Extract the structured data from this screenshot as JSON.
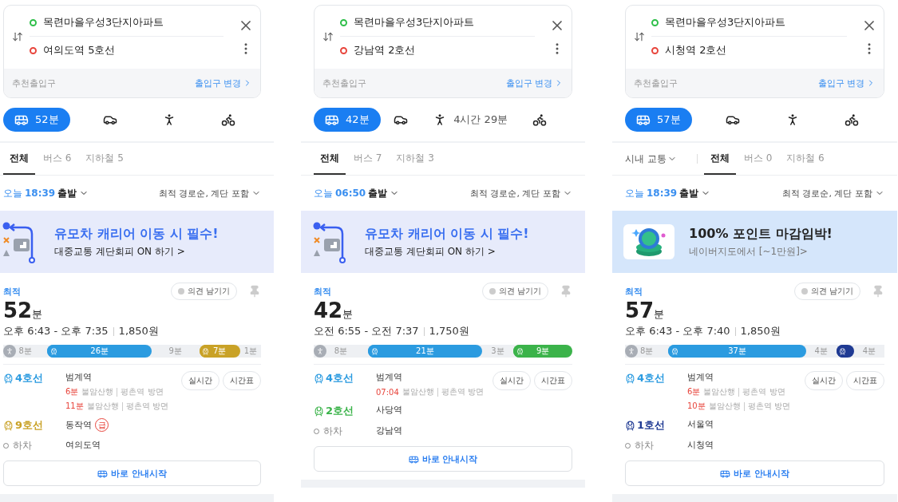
{
  "panels": [
    {
      "search": {
        "origin": "목련마을우성3단지아파트",
        "destination": "여의도역 5호선",
        "entrance_label": "추천출입구",
        "entrance_link": "출입구 변경"
      },
      "modes": [
        {
          "kind": "transit",
          "label": "52분",
          "selected": true
        },
        {
          "kind": "car",
          "selected": false
        },
        {
          "kind": "walk",
          "selected": false
        },
        {
          "kind": "bike",
          "selected": false
        }
      ],
      "tabs": [
        {
          "kind": "tab",
          "label": "전체",
          "selected": true
        },
        {
          "kind": "tab",
          "label": "버스 6",
          "selected": false
        },
        {
          "kind": "tab",
          "label": "지하철 5",
          "selected": false
        }
      ],
      "departure": {
        "day": "오늘",
        "time": "18:39",
        "suffix": "출발"
      },
      "sort": "최적 경로순, 계단 포함",
      "banner": {
        "kind": "stroller",
        "title": "유모차 캐리어 이동 시 필수!",
        "subtitle": "대중교통 계단회피 ON 하기 >"
      },
      "route": {
        "tag": "최적",
        "feedback": "의견 남기기",
        "duration": "52",
        "unit": "분",
        "times": "오후 6:43 - 오후 7:35",
        "fare": "1,850원",
        "segments": [
          {
            "kind": "walk",
            "label": "8분"
          },
          {
            "kind": "ride",
            "label": "26분",
            "color": "#2b9be0"
          },
          {
            "kind": "gap",
            "label": "9분"
          },
          {
            "kind": "ride",
            "label": "7분",
            "color": "#c9a227"
          },
          {
            "kind": "gap",
            "label": "1분"
          }
        ],
        "legs": [
          {
            "kind": "line",
            "name": "4호선",
            "color": "#2b9be0",
            "station": "범계역",
            "actions": [
              "실시간",
              "시간표"
            ],
            "arrivals": [
              {
                "wait": "6분",
                "dest": "불암산행",
                "direction": "평촌역 방면"
              },
              {
                "wait": "11분",
                "dest": "불암산행",
                "direction": "평촌역 방면"
              }
            ]
          },
          {
            "kind": "line",
            "name": "9호선",
            "color": "#c9a227",
            "station": "동작역",
            "badge": "급"
          },
          {
            "kind": "alight",
            "name": "하차",
            "station": "여의도역"
          }
        ],
        "start": "바로 안내시작"
      }
    },
    {
      "search": {
        "origin": "목련마을우성3단지아파트",
        "destination": "강남역 2호선",
        "entrance_label": "추천출입구",
        "entrance_link": "출입구 변경"
      },
      "modes": [
        {
          "kind": "transit",
          "label": "42분",
          "selected": true
        },
        {
          "kind": "car",
          "selected": false
        },
        {
          "kind": "walk",
          "label": "4시간 29분",
          "selected": false
        },
        {
          "kind": "bike",
          "selected": false
        }
      ],
      "tabs": [
        {
          "kind": "tab",
          "label": "전체",
          "selected": true
        },
        {
          "kind": "tab",
          "label": "버스 7",
          "selected": false
        },
        {
          "kind": "tab",
          "label": "지하철 3",
          "selected": false
        }
      ],
      "departure": {
        "day": "오늘",
        "time": "06:50",
        "suffix": "출발"
      },
      "sort": "최적 경로순, 계단 포함",
      "banner": {
        "kind": "stroller",
        "title": "유모차 캐리어 이동 시 필수!",
        "subtitle": "대중교통 계단회피 ON 하기 >"
      },
      "route": {
        "tag": "최적",
        "feedback": "의견 남기기",
        "duration": "42",
        "unit": "분",
        "times": "오전 6:55 - 오전 7:37",
        "fare": "1,750원",
        "segments": [
          {
            "kind": "walk",
            "label": "8분"
          },
          {
            "kind": "ride",
            "label": "21분",
            "color": "#2b9be0"
          },
          {
            "kind": "gap",
            "label": "3분"
          },
          {
            "kind": "ride",
            "label": "9분",
            "color": "#3bb34a"
          }
        ],
        "legs": [
          {
            "kind": "line",
            "name": "4호선",
            "color": "#2b9be0",
            "station": "범계역",
            "actions": [
              "실시간",
              "시간표"
            ],
            "arrivals": [
              {
                "wait": "07:04",
                "dest": "불암산행",
                "direction": "평촌역 방면"
              }
            ]
          },
          {
            "kind": "line",
            "name": "2호선",
            "color": "#3bb34a",
            "station": "사당역"
          },
          {
            "kind": "alight",
            "name": "하차",
            "station": "강남역"
          }
        ],
        "start": "바로 안내시작"
      }
    },
    {
      "search": {
        "origin": "목련마을우성3단지아파트",
        "destination": "시청역 2호선",
        "entrance_label": "추천출입구",
        "entrance_link": "출입구 변경"
      },
      "modes": [
        {
          "kind": "transit",
          "label": "57분",
          "selected": true
        },
        {
          "kind": "car",
          "selected": false
        },
        {
          "kind": "walk",
          "selected": false
        },
        {
          "kind": "bike",
          "selected": false
        }
      ],
      "tabs": [
        {
          "kind": "dropdown",
          "label": "시내 교통",
          "selected": false
        },
        {
          "kind": "tab",
          "label": "전체",
          "selected": true
        },
        {
          "kind": "tab",
          "label": "버스 0",
          "selected": false
        },
        {
          "kind": "tab",
          "label": "지하철 6",
          "selected": false
        }
      ],
      "departure": {
        "day": "오늘",
        "time": "18:39",
        "suffix": "출발"
      },
      "sort": "최적 경로순, 계단 포함",
      "banner": {
        "kind": "points",
        "title": "100% 포인트 마감임박!",
        "subtitle": "네이버지도에서 [~1만원]>"
      },
      "route": {
        "tag": "최적",
        "feedback": "의견 남기기",
        "duration": "57",
        "unit": "분",
        "times": "오후 6:43 - 오후 7:40",
        "fare": "1,850원",
        "segments": [
          {
            "kind": "walk",
            "label": "8분"
          },
          {
            "kind": "ride",
            "label": "37분",
            "color": "#2b9be0"
          },
          {
            "kind": "gap",
            "label": "4분"
          },
          {
            "kind": "ride",
            "color": "#1f3a93"
          },
          {
            "kind": "gap",
            "label": "4분"
          }
        ],
        "legs": [
          {
            "kind": "line",
            "name": "4호선",
            "color": "#2b9be0",
            "station": "범계역",
            "actions": [
              "실시간",
              "시간표"
            ],
            "arrivals": [
              {
                "wait": "6분",
                "dest": "불암산행",
                "direction": "평촌역 방면"
              },
              {
                "wait": "10분",
                "dest": "불암산행",
                "direction": "평촌역 방면"
              }
            ]
          },
          {
            "kind": "line",
            "name": "1호선",
            "color": "#1f3a93",
            "station": "서울역"
          },
          {
            "kind": "alight",
            "name": "하차",
            "station": "시청역"
          }
        ],
        "start": "바로 안내시작"
      }
    }
  ]
}
